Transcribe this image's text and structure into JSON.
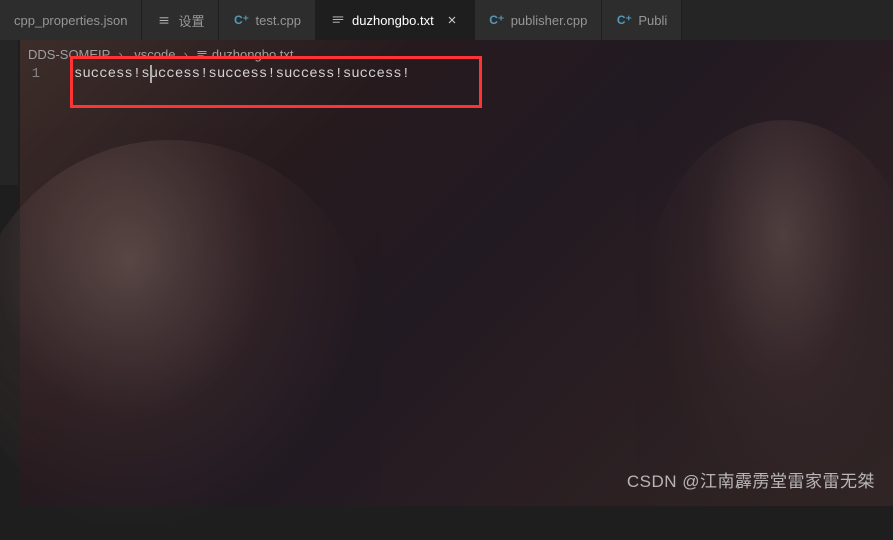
{
  "tabs": [
    {
      "label": "cpp_properties.json",
      "icon": "settings",
      "active": false
    },
    {
      "label": "设置",
      "icon": "settings",
      "active": false
    },
    {
      "label": "test.cpp",
      "icon": "cpp",
      "active": false
    },
    {
      "label": "duzhongbo.txt",
      "icon": "txt",
      "active": true,
      "closable": true
    },
    {
      "label": "publisher.cpp",
      "icon": "cpp",
      "active": false
    },
    {
      "label": "Publi",
      "icon": "cpp",
      "active": false
    }
  ],
  "breadcrumb": {
    "parts": [
      "DDS-SOMEIP",
      ".vscode",
      "duzhongbo.txt"
    ]
  },
  "editor": {
    "line_number": "1",
    "content": "success!success!success!success!success!"
  },
  "watermark": "CSDN @江南霹雳堂雷家雷无桀"
}
